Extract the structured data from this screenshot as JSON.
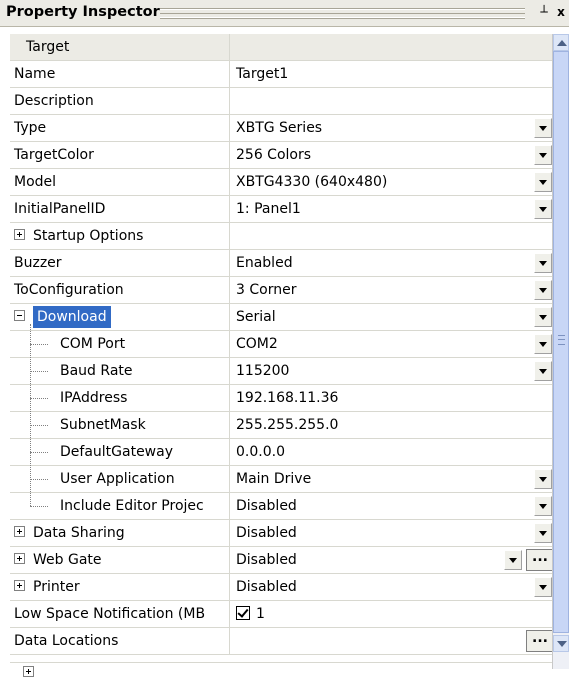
{
  "window": {
    "title": "Property Inspector",
    "pin_glyph": "┴",
    "close_glyph": "x"
  },
  "header": {
    "name": "Target",
    "value": ""
  },
  "rows": [
    {
      "name": "Name",
      "value": "Target1",
      "control": "none"
    },
    {
      "name": "Description",
      "value": "",
      "control": "none"
    },
    {
      "name": "Type",
      "value": "XBTG Series",
      "control": "dropdown"
    },
    {
      "name": "TargetColor",
      "value": "256 Colors",
      "control": "dropdown"
    },
    {
      "name": "Model",
      "value": "XBTG4330 (640x480)",
      "control": "dropdown"
    },
    {
      "name": "InitialPanelID",
      "value": "1: Panel1",
      "control": "dropdown"
    },
    {
      "name": "Startup Options",
      "value": "",
      "control": "none",
      "expander": "plus"
    },
    {
      "name": "Buzzer",
      "value": "Enabled",
      "control": "dropdown"
    },
    {
      "name": "ToConfiguration",
      "value": "3 Corner",
      "control": "dropdown"
    },
    {
      "name": "Download",
      "value": "Serial",
      "control": "dropdown",
      "expander": "minus",
      "selected": true
    },
    {
      "name": "COM Port",
      "value": "COM2",
      "control": "dropdown",
      "child": true
    },
    {
      "name": "Baud Rate",
      "value": "115200",
      "control": "dropdown",
      "child": true
    },
    {
      "name": "IPAddress",
      "value": "192.168.11.36",
      "control": "none",
      "child": true
    },
    {
      "name": "SubnetMask",
      "value": "255.255.255.0",
      "control": "none",
      "child": true
    },
    {
      "name": "DefaultGateway",
      "value": "0.0.0.0",
      "control": "none",
      "child": true
    },
    {
      "name": "User Application",
      "value": "Main Drive",
      "control": "dropdown",
      "child": true
    },
    {
      "name": "Include Editor Projec",
      "value": "Disabled",
      "control": "dropdown",
      "child": true,
      "last_child": true
    },
    {
      "name": "Data Sharing",
      "value": "Disabled",
      "control": "dropdown",
      "expander": "plus"
    },
    {
      "name": "Web Gate",
      "value": "Disabled",
      "control": "dropdown-ellipsis",
      "expander": "plus"
    },
    {
      "name": "Printer",
      "value": "Disabled",
      "control": "dropdown",
      "expander": "plus"
    },
    {
      "name": "Low Space Notification (MB",
      "value": "1",
      "control": "checkbox",
      "checked": true
    },
    {
      "name": "Data Locations",
      "value": "",
      "control": "ellipsis"
    }
  ],
  "ellipsis_label": "...",
  "colors": {
    "selection": "#316ac5",
    "header_bg": "#ecebe5",
    "scrollbar_thumb": "#c8d6f6"
  }
}
